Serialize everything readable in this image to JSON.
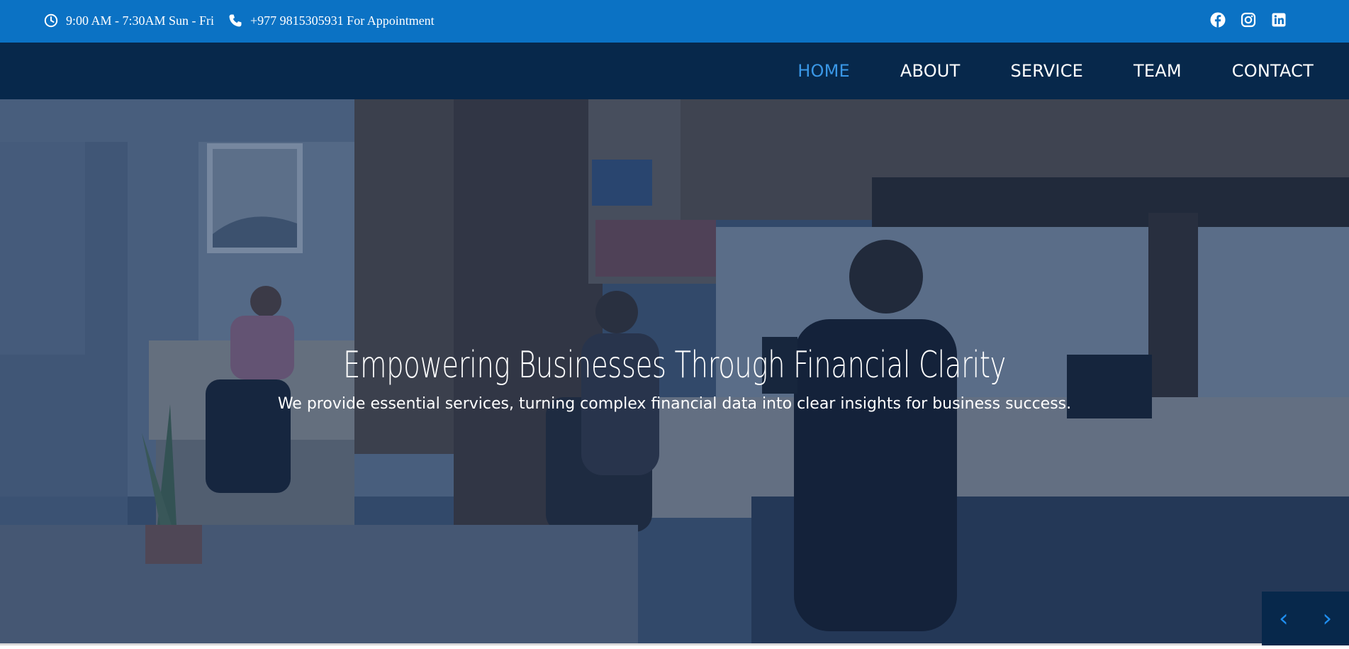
{
  "topbar": {
    "hours": "9:00 AM - 7:30AM Sun - Fri",
    "phone": "+977 9815305931 For Appointment",
    "icons": {
      "hours": "clock-icon",
      "phone": "phone-icon"
    },
    "social": [
      "facebook-icon",
      "instagram-icon",
      "linkedin-icon"
    ],
    "bg_color": "#0b72c4"
  },
  "nav": {
    "bg_color": "#07284b",
    "active_color": "#3a97e6",
    "items": [
      {
        "label": "HOME",
        "active": true
      },
      {
        "label": "ABOUT",
        "active": false
      },
      {
        "label": "SERVICE",
        "active": false
      },
      {
        "label": "TEAM",
        "active": false
      },
      {
        "label": "CONTACT",
        "active": false
      }
    ]
  },
  "hero": {
    "title": "Empowering Businesses Through Financial Clarity",
    "subtitle": "We provide essential services, turning complex financial data into clear insights for business success.",
    "controls": {
      "prev": "‹",
      "next": "›"
    },
    "arrow_color": "#1f8ef0"
  }
}
